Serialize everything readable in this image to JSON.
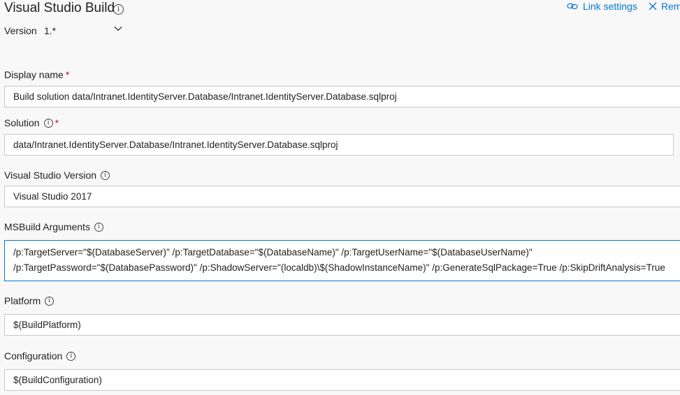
{
  "header": {
    "title": "Visual Studio Build",
    "info_icon": "info-icon",
    "link_settings": "Link settings",
    "link_icon": "link-icon",
    "remove": "Rem",
    "remove_icon": "close-icon"
  },
  "version": {
    "label": "Version",
    "value": "1.*"
  },
  "fields": {
    "display_name": {
      "label": "Display name",
      "required": "*",
      "value": "Build solution data/Intranet.IdentityServer.Database/Intranet.IdentityServer.Database.sqlproj"
    },
    "solution": {
      "label": "Solution",
      "required": "*",
      "value": "data/Intranet.IdentityServer.Database/Intranet.IdentityServer.Database.sqlproj"
    },
    "vs_version": {
      "label": "Visual Studio Version",
      "value": "Visual Studio 2017"
    },
    "msbuild_args": {
      "label": "MSBuild Arguments",
      "value": "/p:TargetServer=\"$(DatabaseServer)\" /p:TargetDatabase=\"$(DatabaseName)\" /p:TargetUserName=\"$(DatabaseUserName)\" /p:TargetPassword=\"$(DatabasePassword)\" /p:ShadowServer=\"(localdb)\\$(ShadowInstanceName)\" /p:GenerateSqlPackage=True /p:SkipDriftAnalysis=True"
    },
    "platform": {
      "label": "Platform",
      "value": "$(BuildPlatform)"
    },
    "configuration": {
      "label": "Configuration",
      "value": "$(BuildConfiguration)"
    }
  },
  "accent_color": "#0078d4",
  "required_color": "#c50f1f"
}
